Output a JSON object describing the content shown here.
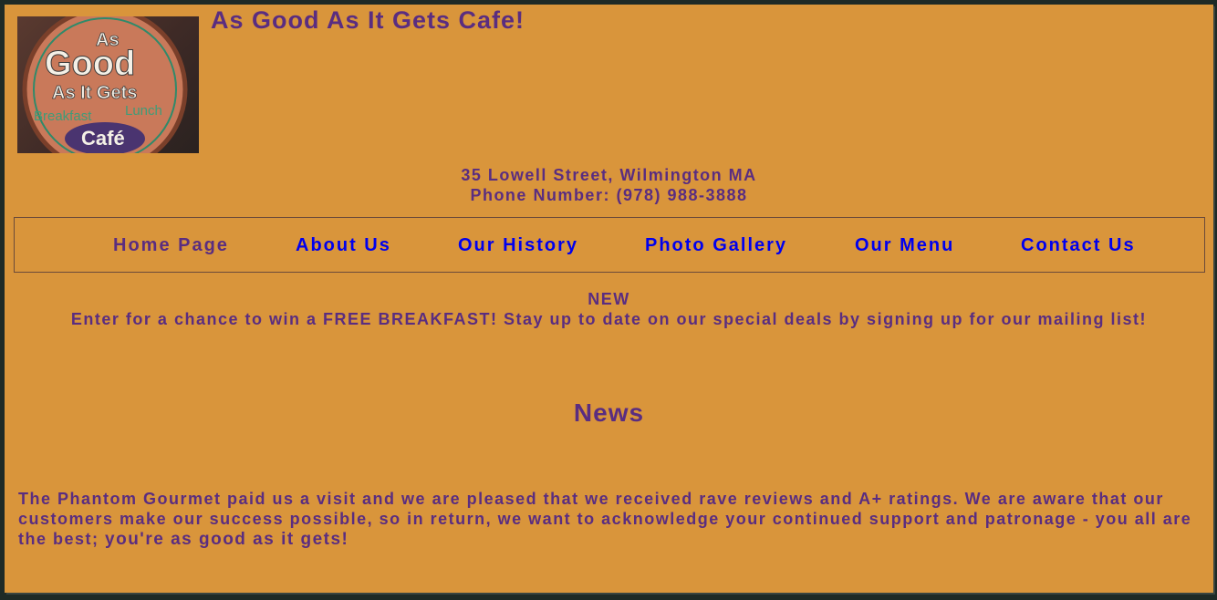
{
  "site": {
    "title": "As Good As It Gets Cafe!",
    "logo": {
      "line1": "As",
      "line2": "Good",
      "line3": "As It Gets",
      "left_label": "Breakfast",
      "right_label": "Lunch",
      "bottom_label": "Café"
    }
  },
  "contact": {
    "address": "35 Lowell Street, Wilmington MA",
    "phone": "Phone Number: (978) 988-3888"
  },
  "nav": {
    "items": [
      {
        "label": "Home Page",
        "visited": true
      },
      {
        "label": "About Us",
        "visited": false
      },
      {
        "label": "Our History",
        "visited": false
      },
      {
        "label": "Photo Gallery",
        "visited": false
      },
      {
        "label": "Our Menu",
        "visited": false
      },
      {
        "label": "Contact Us",
        "visited": false
      }
    ]
  },
  "promo": {
    "tag": "NEW",
    "text": "Enter for a chance to win a FREE BREAKFAST! Stay up to date on our special deals by signing up for our mailing list!"
  },
  "news": {
    "heading": "News",
    "body": "The Phantom Gourmet paid us a visit and we are pleased that we received rave reviews and A+ ratings. We are aware that our customers make our success possible, so in return, we want to acknowledge your continued support and patronage - you all are the best;",
    "emphasis": "you're as good as it gets!"
  },
  "colors": {
    "background": "#d9953b",
    "text": "#5a2d80",
    "link": "#0000ee",
    "visited_link": "#5a2d80"
  }
}
